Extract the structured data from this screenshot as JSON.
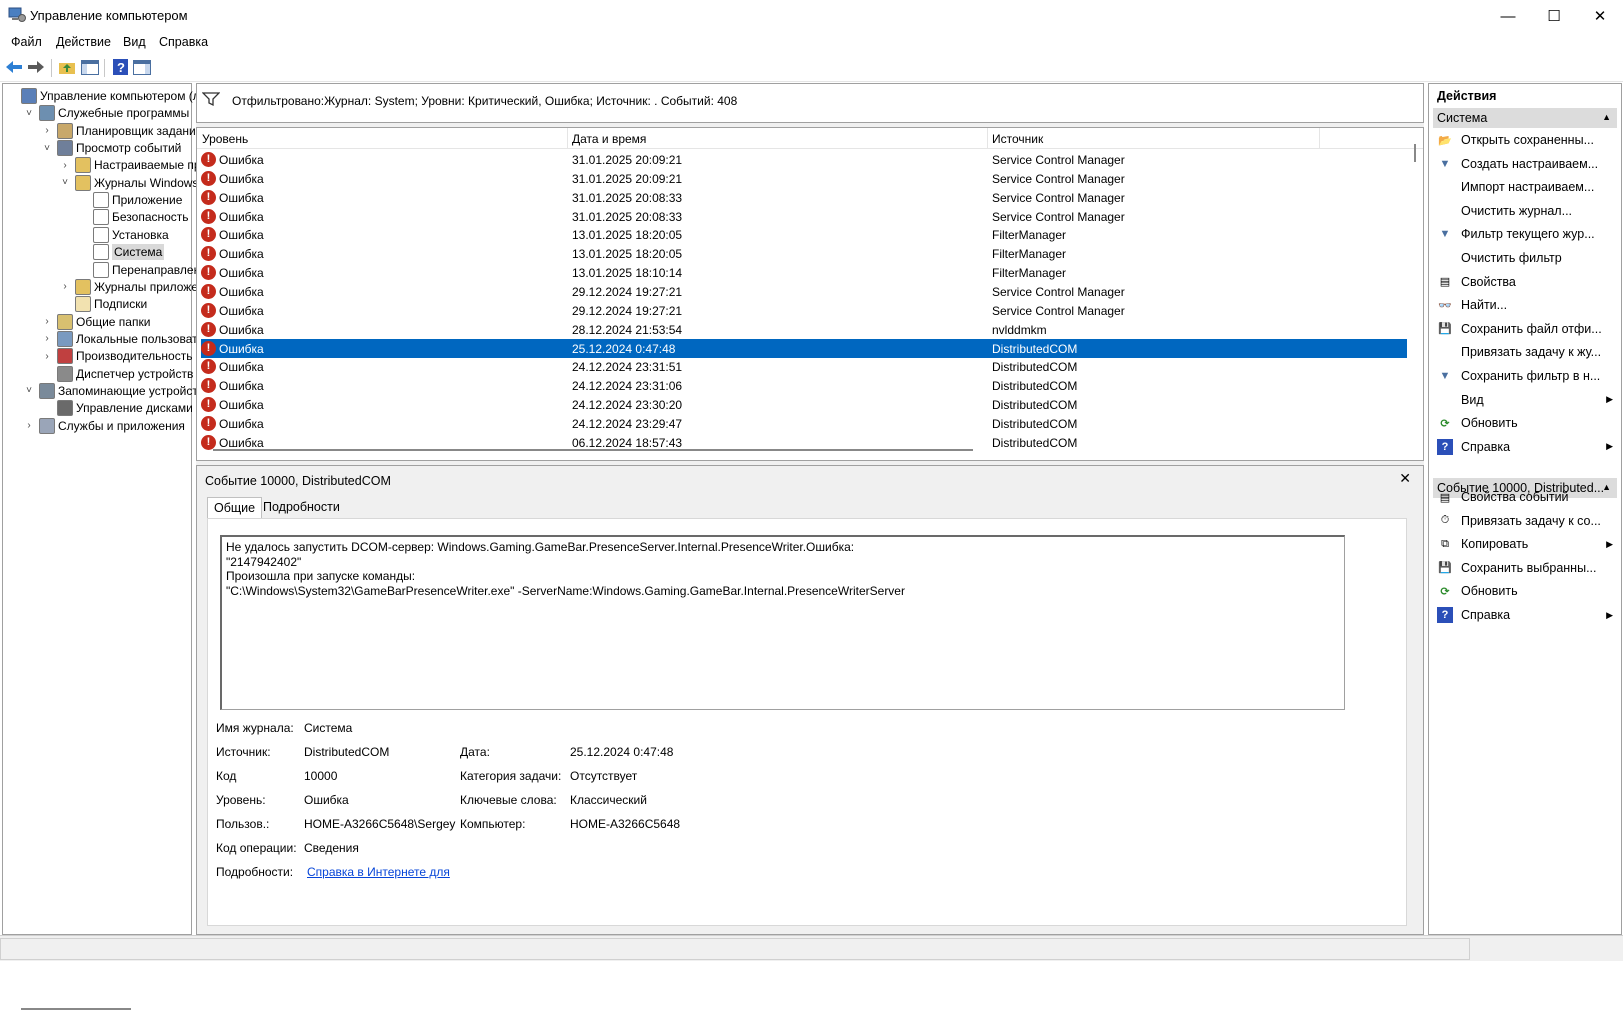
{
  "window": {
    "title": "Управление компьютером"
  },
  "menu": [
    "Файл",
    "Действие",
    "Вид",
    "Справка"
  ],
  "tree": [
    {
      "label": "Управление компьютером (л",
      "level": 0,
      "exp": ""
    },
    {
      "label": "Служебные программы",
      "level": 1,
      "exp": "˅"
    },
    {
      "label": "Планировщик заданий",
      "level": 2,
      "exp": "›"
    },
    {
      "label": "Просмотр событий",
      "level": 2,
      "exp": "˅"
    },
    {
      "label": "Настраиваемые пр",
      "level": 3,
      "exp": "›"
    },
    {
      "label": "Журналы Windows",
      "level": 3,
      "exp": "˅"
    },
    {
      "label": "Приложение",
      "level": 4,
      "exp": ""
    },
    {
      "label": "Безопасность",
      "level": 4,
      "exp": ""
    },
    {
      "label": "Установка",
      "level": 4,
      "exp": ""
    },
    {
      "label": "Система",
      "level": 4,
      "exp": "",
      "selected": true
    },
    {
      "label": "Перенаправлен",
      "level": 4,
      "exp": ""
    },
    {
      "label": "Журналы приложе",
      "level": 3,
      "exp": "›"
    },
    {
      "label": "Подписки",
      "level": 3,
      "exp": ""
    },
    {
      "label": "Общие папки",
      "level": 2,
      "exp": "›"
    },
    {
      "label": "Локальные пользовате",
      "level": 2,
      "exp": "›"
    },
    {
      "label": "Производительность",
      "level": 2,
      "exp": "›"
    },
    {
      "label": "Диспетчер устройств",
      "level": 2,
      "exp": ""
    },
    {
      "label": "Запоминающие устройст",
      "level": 1,
      "exp": "˅"
    },
    {
      "label": "Управление дисками",
      "level": 2,
      "exp": ""
    },
    {
      "label": "Службы и приложения",
      "level": 1,
      "exp": "›"
    }
  ],
  "filter": {
    "text": "Отфильтровано:Журнал: System; Уровни: Критический, Ошибка; Источник: . Событий: 408"
  },
  "grid": {
    "columns": [
      "Уровень",
      "Дата и время",
      "Источник"
    ],
    "rows": [
      {
        "level": "Ошибка",
        "date": "31.01.2025 20:09:21",
        "source": "Service Control Manager"
      },
      {
        "level": "Ошибка",
        "date": "31.01.2025 20:09:21",
        "source": "Service Control Manager"
      },
      {
        "level": "Ошибка",
        "date": "31.01.2025 20:08:33",
        "source": "Service Control Manager"
      },
      {
        "level": "Ошибка",
        "date": "31.01.2025 20:08:33",
        "source": "Service Control Manager"
      },
      {
        "level": "Ошибка",
        "date": "13.01.2025 18:20:05",
        "source": "FilterManager"
      },
      {
        "level": "Ошибка",
        "date": "13.01.2025 18:20:05",
        "source": "FilterManager"
      },
      {
        "level": "Ошибка",
        "date": "13.01.2025 18:10:14",
        "source": "FilterManager"
      },
      {
        "level": "Ошибка",
        "date": "29.12.2024 19:27:21",
        "source": "Service Control Manager"
      },
      {
        "level": "Ошибка",
        "date": "29.12.2024 19:27:21",
        "source": "Service Control Manager"
      },
      {
        "level": "Ошибка",
        "date": "28.12.2024 21:53:54",
        "source": "nvlddmkm"
      },
      {
        "level": "Ошибка",
        "date": "25.12.2024 0:47:48",
        "source": "DistributedCOM",
        "selected": true
      },
      {
        "level": "Ошибка",
        "date": "24.12.2024 23:31:51",
        "source": "DistributedCOM"
      },
      {
        "level": "Ошибка",
        "date": "24.12.2024 23:31:06",
        "source": "DistributedCOM"
      },
      {
        "level": "Ошибка",
        "date": "24.12.2024 23:30:20",
        "source": "DistributedCOM"
      },
      {
        "level": "Ошибка",
        "date": "24.12.2024 23:29:47",
        "source": "DistributedCOM"
      },
      {
        "level": "Ошибка",
        "date": "06.12.2024 18:57:43",
        "source": "DistributedCOM"
      }
    ]
  },
  "detail": {
    "title": "Событие 10000, DistributedCOM",
    "tabs": [
      "Общие",
      "Подробности"
    ],
    "message": "Не удалось запустить DCOM-сервер: Windows.Gaming.GameBar.PresenceServer.Internal.PresenceWriter.Ошибка:\n\"2147942402\"\nПроизошла при запуске команды:\n\"C:\\Windows\\System32\\GameBarPresenceWriter.exe\" -ServerName:Windows.Gaming.GameBar.Internal.PresenceWriterServer",
    "props": {
      "log_label": "Имя журнала:",
      "log_value": "Система",
      "source_label": "Источник:",
      "source_value": "DistributedCOM",
      "date_label": "Дата:",
      "date_value": "25.12.2024 0:47:48",
      "code_label": "Код",
      "code_value": "10000",
      "task_label": "Категория задачи:",
      "task_value": "Отсутствует",
      "level_label": "Уровень:",
      "level_value": "Ошибка",
      "keywords_label": "Ключевые слова:",
      "keywords_value": "Классический",
      "user_label": "Пользов.:",
      "user_value": "HOME-A3266C5648\\Sergey",
      "computer_label": "Компьютер:",
      "computer_value": "HOME-A3266C5648",
      "opcode_label": "Код операции:",
      "opcode_value": "Сведения",
      "more_label": "Подробности:",
      "more_link": "Справка в Интернете для"
    }
  },
  "actions": {
    "header": "Действия",
    "section1": "Система",
    "items1": [
      {
        "label": "Открыть сохраненны...",
        "icon": "open-folder-icon",
        "glyph": "📂",
        "arrow": false
      },
      {
        "label": "Создать настраиваем...",
        "icon": "create-filter-icon",
        "glyph": "▼",
        "arrow": false
      },
      {
        "label": "Импорт настраиваем...",
        "icon": "",
        "glyph": "",
        "arrow": false
      },
      {
        "label": "Очистить журнал...",
        "icon": "",
        "glyph": "",
        "arrow": false
      },
      {
        "label": "Фильтр текущего жур...",
        "icon": "filter-icon",
        "glyph": "▼",
        "arrow": false
      },
      {
        "label": "Очистить фильтр",
        "icon": "",
        "glyph": "",
        "arrow": false
      },
      {
        "label": "Свойства",
        "icon": "properties-icon",
        "glyph": "▤",
        "arrow": false
      },
      {
        "label": "Найти...",
        "icon": "binoculars-icon",
        "glyph": "👓",
        "arrow": false
      },
      {
        "label": "Сохранить файл отфи...",
        "icon": "save-icon",
        "glyph": "💾",
        "arrow": false
      },
      {
        "label": "Привязать задачу к жу...",
        "icon": "",
        "glyph": "",
        "arrow": false
      },
      {
        "label": "Сохранить фильтр в н...",
        "icon": "save-filter-icon",
        "glyph": "▼",
        "arrow": false
      },
      {
        "label": "Вид",
        "icon": "",
        "glyph": "",
        "arrow": true
      },
      {
        "label": "Обновить",
        "icon": "refresh-icon",
        "glyph": "⟳",
        "arrow": false
      },
      {
        "label": "Справка",
        "icon": "help-icon",
        "glyph": "?",
        "arrow": true
      }
    ],
    "section2": "Событие 10000, Distributed...",
    "items2": [
      {
        "label": "Свойства событий",
        "icon": "event-properties-icon",
        "glyph": "▤",
        "arrow": false
      },
      {
        "label": "Привязать задачу к со...",
        "icon": "attach-task-icon",
        "glyph": "⏱",
        "arrow": false
      },
      {
        "label": "Копировать",
        "icon": "copy-icon",
        "glyph": "⧉",
        "arrow": true
      },
      {
        "label": "Сохранить выбранны...",
        "icon": "save-icon",
        "glyph": "💾",
        "arrow": false
      },
      {
        "label": "Обновить",
        "icon": "refresh-icon",
        "glyph": "⟳",
        "arrow": false
      },
      {
        "label": "Справка",
        "icon": "help-icon",
        "glyph": "?",
        "arrow": true
      }
    ]
  }
}
